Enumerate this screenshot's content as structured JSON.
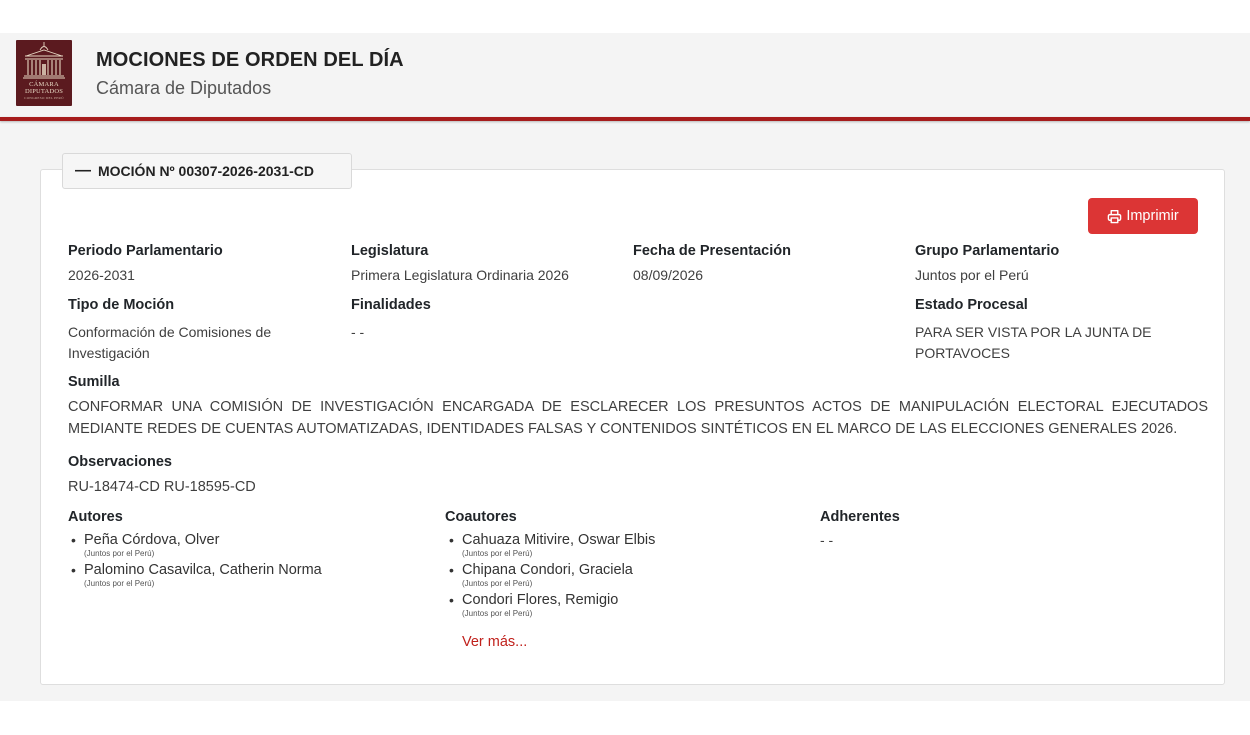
{
  "header": {
    "title": "MOCIONES DE ORDEN DEL DÍA",
    "subtitle": "Cámara de Diputados",
    "logo": {
      "line1": "CÁMARA",
      "line2": "DIPUTADOS",
      "line3": "CONGRESO DEL PERÚ",
      "icon": "congress-building-logo"
    },
    "accent_color": "#a61c1c"
  },
  "motion": {
    "toggle_symbol": "—",
    "title": "MOCIÓN Nº 00307-2026-2031-CD",
    "print_label": "Imprimir",
    "print_icon": "printer-icon",
    "print_color": "#dc3535",
    "fields": {
      "periodo_label": "Periodo Parlamentario",
      "periodo_value": "2026-2031",
      "legislatura_label": "Legislatura",
      "legislatura_value": "Primera Legislatura Ordinaria 2026",
      "fecha_label": "Fecha de Presentación",
      "fecha_value": "08/09/2026",
      "grupo_label": "Grupo Parlamentario",
      "grupo_value": "Juntos por el Perú",
      "tipo_label": "Tipo de Moción",
      "tipo_value_line1": "Conformación de Comisiones de",
      "tipo_value_line2": "Investigación",
      "finalidades_label": "Finalidades",
      "finalidades_value": "- -",
      "estado_label": "Estado Procesal",
      "estado_value_line1": "PARA SER VISTA POR LA JUNTA DE",
      "estado_value_line2": "PORTAVOCES",
      "sumilla_label": "Sumilla",
      "sumilla_value": "CONFORMAR UNA COMISIÓN DE INVESTIGACIÓN ENCARGADA DE ESCLARECER LOS PRESUNTOS ACTOS DE MANIPULACIÓN ELECTORAL EJECUTADOS MEDIANTE REDES DE CUENTAS AUTOMATIZADAS, IDENTIDADES FALSAS Y CONTENIDOS SINTÉTICOS EN EL MARCO DE LAS ELECCIONES GENERALES 2026.",
      "observaciones_label": "Observaciones",
      "observaciones_value": "RU-18474-CD RU-18595-CD"
    },
    "autores_label": "Autores",
    "autores": [
      {
        "name": "Peña Córdova, Olver",
        "party": "(Juntos por el Perú)"
      },
      {
        "name": "Palomino Casavilca, Catherin Norma",
        "party": "(Juntos por el Perú)"
      }
    ],
    "coautores_label": "Coautores",
    "coautores": [
      {
        "name": "Cahuaza Mitivire, Oswar Elbis",
        "party": "(Juntos por el Perú)"
      },
      {
        "name": "Chipana Condori, Graciela",
        "party": "(Juntos por el Perú)"
      },
      {
        "name": "Condori Flores, Remigio",
        "party": "(Juntos por el Perú)"
      }
    ],
    "ver_mas": "Ver más...",
    "adherentes_label": "Adherentes",
    "adherentes_value": "- -"
  }
}
